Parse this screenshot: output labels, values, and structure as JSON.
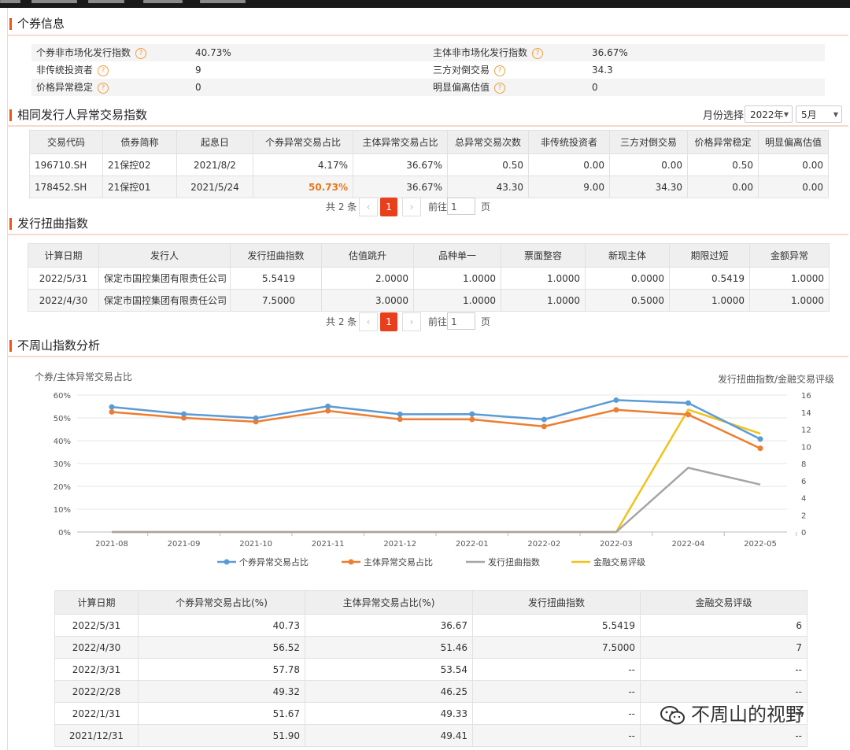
{
  "topbar_items": [
    "",
    "",
    "",
    "",
    ""
  ],
  "sections": {
    "bond_info": "个券信息",
    "same_issuer": "相同发行人异常交易指数",
    "issuer_distortion": "发行扭曲指数",
    "analysis": "不周山指数分析"
  },
  "bond_info": {
    "rows": [
      {
        "k1": "个券非市场化发行指数",
        "v1": "40.73%",
        "k2": "主体非市场化发行指数",
        "v2": "36.67%"
      },
      {
        "k1": "非传统投资者",
        "v1": "9",
        "k2": "三方对倒交易",
        "v2": "34.3"
      },
      {
        "k1": "价格异常稳定",
        "v1": "0",
        "k2": "明显偏离估值",
        "v2": "0"
      }
    ],
    "help_glyph": "?"
  },
  "month_select": {
    "label": "月份选择",
    "year": "2022年",
    "month": "5月"
  },
  "same_issuer_table": {
    "headers": [
      "交易代码",
      "债券简称",
      "起息日",
      "个券异常交易占比",
      "主体异常交易占比",
      "总异常交易次数",
      "非传统投资者",
      "三方对倒交易",
      "价格异常稳定",
      "明显偏离估值"
    ],
    "rows": [
      [
        "196710.SH",
        "21保控02",
        "2021/8/2",
        "4.17%",
        "36.67%",
        "0.50",
        "0.00",
        "0.00",
        "0.50",
        "0.00"
      ],
      [
        "178452.SH",
        "21保控01",
        "2021/5/24",
        "50.73%",
        "36.67%",
        "43.30",
        "9.00",
        "34.30",
        "0.00",
        "0.00"
      ]
    ]
  },
  "pager1": {
    "total": "共 2 条",
    "prev": "‹",
    "page": "1",
    "next": "›",
    "goto": "前往",
    "input": "1",
    "unit": "页"
  },
  "distortion_table": {
    "headers": [
      "计算日期",
      "发行人",
      "发行扭曲指数",
      "估值跳升",
      "品种单一",
      "票面整容",
      "新现主体",
      "期限过短",
      "金额异常"
    ],
    "rows": [
      [
        "2022/5/31",
        "保定市国控集团有限责任公司",
        "5.5419",
        "2.0000",
        "1.0000",
        "1.0000",
        "0.0000",
        "0.5419",
        "1.0000"
      ],
      [
        "2022/4/30",
        "保定市国控集团有限责任公司",
        "7.5000",
        "3.0000",
        "1.0000",
        "1.0000",
        "0.5000",
        "1.0000",
        "1.0000"
      ]
    ]
  },
  "pager2": {
    "total": "共 2 条",
    "prev": "‹",
    "page": "1",
    "next": "›",
    "goto": "前往",
    "input": "1",
    "unit": "页"
  },
  "chart_data": {
    "type": "line",
    "ylabel_left": "个券/主体异常交易占比",
    "ylabel_right": "发行扭曲指数/金融交易评级",
    "categories": [
      "2021-08",
      "2021-09",
      "2021-10",
      "2021-11",
      "2021-12",
      "2022-01",
      "2022-02",
      "2022-03",
      "2022-04",
      "2022-05"
    ],
    "left_ticks": [
      "0%",
      "10%",
      "20%",
      "30%",
      "40%",
      "50%",
      "60%"
    ],
    "right_ticks": [
      "0",
      "2",
      "4",
      "6",
      "8",
      "10",
      "12",
      "14",
      "16"
    ],
    "ylim_left": [
      0,
      60
    ],
    "ylim_right": [
      0,
      16
    ],
    "series": [
      {
        "name": "个券异常交易占比",
        "axis": "left",
        "color": "#5b9bd5",
        "marker": true,
        "values": [
          54.8,
          51.7,
          49.9,
          55.1,
          51.6,
          51.67,
          49.32,
          57.78,
          56.52,
          40.73
        ]
      },
      {
        "name": "主体异常交易占比",
        "axis": "left",
        "color": "#ed7d31",
        "marker": true,
        "values": [
          52.6,
          50.0,
          48.3,
          53.1,
          49.41,
          49.33,
          46.25,
          53.54,
          51.46,
          36.67
        ]
      },
      {
        "name": "发行扭曲指数",
        "axis": "right",
        "color": "#a5a5a5",
        "marker": false,
        "values": [
          0,
          0,
          0,
          0,
          0,
          0,
          0,
          0,
          7.5,
          5.5419
        ]
      },
      {
        "name": "金融交易评级",
        "axis": "right",
        "color": "#f2c218",
        "marker": false,
        "values": [
          0,
          0,
          0,
          0,
          0,
          0,
          0,
          0,
          14.3,
          11.5
        ]
      }
    ],
    "legend_position": "bottom",
    "grid": true
  },
  "analysis_table": {
    "headers": [
      "计算日期",
      "个券异常交易占比(%)",
      "主体异常交易占比(%)",
      "发行扭曲指数",
      "金融交易评级"
    ],
    "rows": [
      [
        "2022/5/31",
        "40.73",
        "36.67",
        "5.5419",
        "6"
      ],
      [
        "2022/4/30",
        "56.52",
        "51.46",
        "7.5000",
        "7"
      ],
      [
        "2022/3/31",
        "57.78",
        "53.54",
        "--",
        "--"
      ],
      [
        "2022/2/28",
        "49.32",
        "46.25",
        "--",
        "--"
      ],
      [
        "2022/1/31",
        "51.67",
        "49.33",
        "--",
        "--"
      ],
      [
        "2021/12/31",
        "51.90",
        "49.41",
        "--",
        "--"
      ]
    ]
  },
  "watermark": "不周山的视野"
}
